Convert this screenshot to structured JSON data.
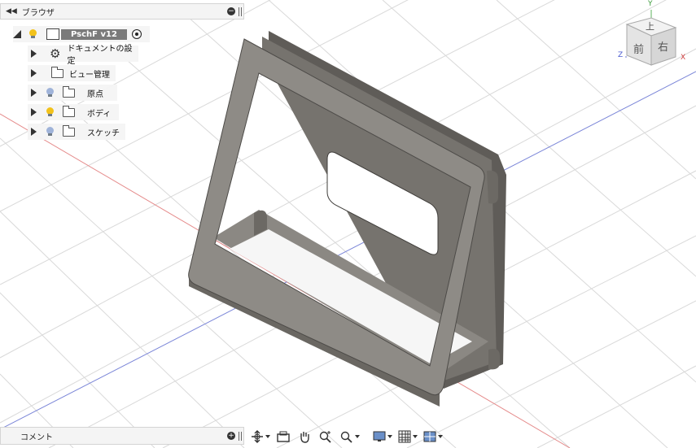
{
  "browser": {
    "title": "ブラウザ",
    "root": {
      "name": "PschF v12"
    },
    "items": [
      {
        "label": "ドキュメントの設定",
        "icon": "gear-icon"
      },
      {
        "label": "ビュー管理",
        "icon": "folder-icon"
      },
      {
        "label": "原点",
        "icon": "folder-icon",
        "bulb": "off"
      },
      {
        "label": "ボディ",
        "icon": "folder-icon",
        "bulb": "on"
      },
      {
        "label": "スケッチ",
        "icon": "folder-icon",
        "bulb": "off"
      }
    ]
  },
  "viewcube": {
    "top": "上",
    "front": "前",
    "right": "右",
    "axis_x": "X",
    "axis_y": "Y",
    "axis_z": "Z"
  },
  "comments": {
    "title": "コメント"
  },
  "colors": {
    "bulb_on": "#f2c21b",
    "bulb_off": "#9fb3d9",
    "body_dark": "#6e6b66",
    "body_light": "#8d8a85"
  }
}
